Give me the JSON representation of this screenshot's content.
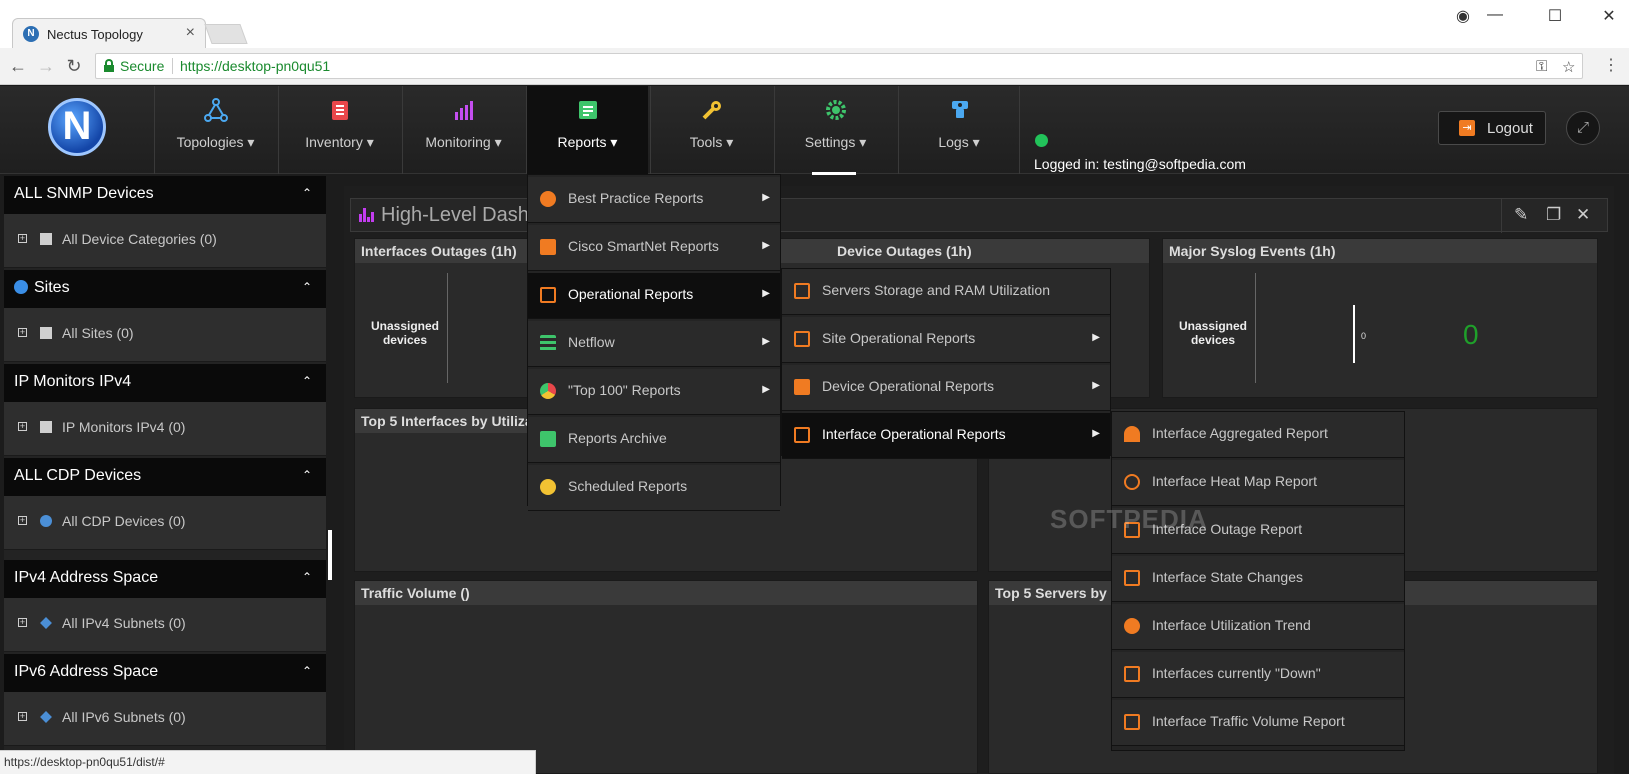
{
  "browser": {
    "tab_title": "Nectus Topology",
    "secure_label": "Secure",
    "url": "https://desktop-pn0qu51",
    "status_url": "https://desktop-pn0qu51/dist/#"
  },
  "app": {
    "logo_letter": "N",
    "nav": [
      {
        "label": "Topologies",
        "icon": "topology-icon",
        "color": "#4ba8f0"
      },
      {
        "label": "Inventory",
        "icon": "inventory-icon",
        "color": "#e8474a"
      },
      {
        "label": "Monitoring",
        "icon": "monitoring-icon",
        "color": "#c44ef0"
      },
      {
        "label": "Reports",
        "icon": "reports-icon",
        "color": "#3ec46b"
      },
      {
        "label": "Tools",
        "icon": "tools-icon",
        "color": "#f2c233"
      },
      {
        "label": "Settings",
        "icon": "settings-icon",
        "color": "#3ec46b"
      },
      {
        "label": "Logs",
        "icon": "logs-icon",
        "color": "#4ba8f0"
      }
    ],
    "logged_in": "Logged in: testing@softpedia.com",
    "logout_label": "Logout"
  },
  "sidebar": {
    "sections": [
      {
        "header": "ALL SNMP Devices",
        "item": "All Device Categories (0)"
      },
      {
        "header": "Sites",
        "item": "All Sites (0)"
      },
      {
        "header": "IP Monitors IPv4",
        "item": "IP Monitors IPv4 (0)"
      },
      {
        "header": "ALL CDP Devices",
        "item": "All CDP Devices (0)"
      },
      {
        "header": "IPv4 Address Space",
        "item": "All IPv4 Subnets (0)"
      },
      {
        "header": "IPv6 Address Space",
        "item": "All IPv6 Subnets (0)"
      }
    ]
  },
  "dashboard": {
    "title": "High-Level Dash",
    "widgets": {
      "interfaces_outages": "Interfaces Outages (1h)",
      "device_outages": "Device Outages (1h)",
      "major_syslog": "Major Syslog Events (1h)",
      "top5_interfaces": "Top 5 Interfaces by Utiliza",
      "traffic_volume": "Traffic Volume ()",
      "top5_servers": "Top 5 Servers by"
    },
    "unassigned_devices": "Unassigned devices",
    "syslog_axis": "0",
    "syslog_count": "0"
  },
  "reports_menu": [
    {
      "label": "Best Practice Reports",
      "color": "#f07b22",
      "submenu": true
    },
    {
      "label": "Cisco SmartNet Reports",
      "color": "#f07b22",
      "submenu": true
    },
    {
      "label": "Operational Reports",
      "color": "#f07b22",
      "submenu": true
    },
    {
      "label": "Netflow",
      "color": "#3ec46b",
      "submenu": true
    },
    {
      "label": "\"Top 100\" Reports",
      "color": "#e8474a",
      "submenu": true
    },
    {
      "label": "Reports Archive",
      "color": "#3ec46b",
      "submenu": false
    },
    {
      "label": "Scheduled Reports",
      "color": "#f2c233",
      "submenu": false
    }
  ],
  "operational_menu": [
    {
      "label": "Servers Storage and RAM Utilization",
      "color": "#f07b22",
      "submenu": false
    },
    {
      "label": "Site Operational Reports",
      "color": "#f07b22",
      "submenu": true
    },
    {
      "label": "Device Operational Reports",
      "color": "#f07b22",
      "submenu": true
    },
    {
      "label": "Interface Operational Reports",
      "color": "#f07b22",
      "submenu": true
    }
  ],
  "interface_menu": [
    {
      "label": "Interface Aggregated Report",
      "color": "#f07b22"
    },
    {
      "label": "Interface Heat Map Report",
      "color": "#f07b22"
    },
    {
      "label": "Interface Outage Report",
      "color": "#f07b22"
    },
    {
      "label": "Interface State Changes",
      "color": "#f07b22"
    },
    {
      "label": "Interface Utilization Trend",
      "color": "#f07b22"
    },
    {
      "label": "Interfaces currently \"Down\"",
      "color": "#f07b22"
    },
    {
      "label": "Interface Traffic Volume Report",
      "color": "#f07b22"
    }
  ],
  "watermark": "SOFTPEDIA"
}
